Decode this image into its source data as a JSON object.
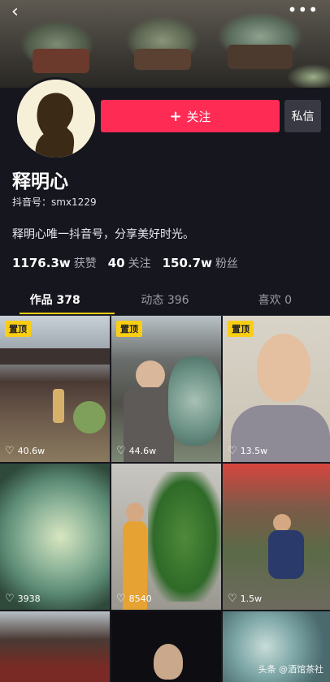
{
  "header": {
    "back_icon": "chevron-left-icon",
    "more_icon": "more-dots-icon"
  },
  "profile": {
    "name": "释明心",
    "account": "抖音号：smx1229",
    "bio": "释明心唯一抖音号，分享美好时光。",
    "follow_label": "关注",
    "message_label": "私信"
  },
  "stats": [
    {
      "value": "1176.3w",
      "label": "获赞"
    },
    {
      "value": "40",
      "label": "关注"
    },
    {
      "value": "150.7w",
      "label": "粉丝"
    }
  ],
  "tabs": [
    {
      "label": "作品 378",
      "active": true
    },
    {
      "label": "动态 396",
      "active": false
    },
    {
      "label": "喜欢 0",
      "active": false
    }
  ],
  "videos": [
    {
      "pinned": "置顶",
      "likes": "40.6w"
    },
    {
      "pinned": "置顶",
      "likes": "44.6w"
    },
    {
      "pinned": "置顶",
      "likes": "13.5w"
    },
    {
      "pinned": "",
      "likes": "3938"
    },
    {
      "pinned": "",
      "likes": "8540"
    },
    {
      "pinned": "",
      "likes": "1.5w"
    },
    {
      "pinned": "",
      "likes": ""
    },
    {
      "pinned": "",
      "likes": ""
    },
    {
      "pinned": "",
      "likes": ""
    }
  ],
  "watermark": "头条 @酒馆茶社",
  "colors": {
    "accent": "#fe2c55",
    "tab_indicator": "#face15",
    "background": "#16161e"
  }
}
